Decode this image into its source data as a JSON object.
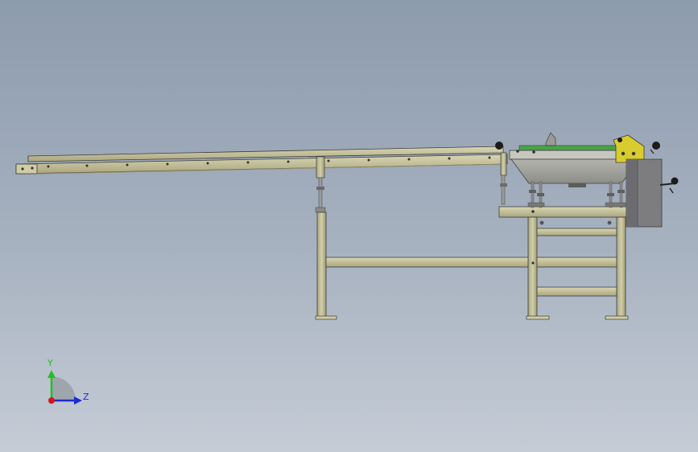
{
  "colors": {
    "background_top": "#8d9bae",
    "background_bottom": "#c5ccd6",
    "frame": "#c7c49a",
    "frame_dark": "#8f8c66",
    "belt": "#4aa34a",
    "bracket": "#d8cc2e",
    "motor": "#7d7d80",
    "outline": "#3d3d3d",
    "axis_x": "#1c2bd6",
    "axis_y": "#23c023",
    "axis_origin": "#d01818"
  },
  "triad": {
    "y_label": "Y",
    "z_label": "Z"
  }
}
